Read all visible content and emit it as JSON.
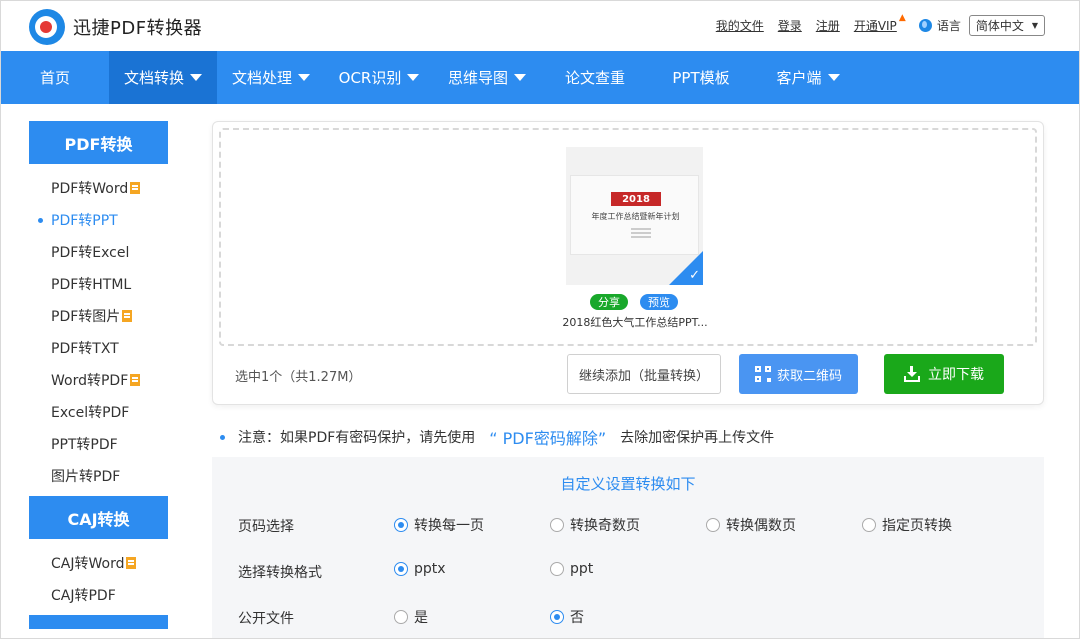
{
  "header": {
    "logo_text": "迅捷PDF转换器",
    "links": [
      "我的文件",
      "登录",
      "注册"
    ],
    "vip_label": "开通VIP",
    "lang_label": "语言",
    "lang_value": "简体中文"
  },
  "nav": {
    "items": [
      {
        "label": "首页"
      },
      {
        "label": "文档转换"
      },
      {
        "label": "文档处理"
      },
      {
        "label": "OCR识别"
      },
      {
        "label": "思维导图"
      },
      {
        "label": "论文查重"
      },
      {
        "label": "PPT模板"
      },
      {
        "label": "客户端"
      }
    ]
  },
  "sidebar": {
    "group1_title": "PDF转换",
    "group1_items": [
      "PDF转Word",
      "PDF转PPT",
      "PDF转Excel",
      "PDF转HTML",
      "PDF转图片",
      "PDF转TXT",
      "Word转PDF",
      "Excel转PDF",
      "PPT转PDF",
      "图片转PDF"
    ],
    "group2_title": "CAJ转换",
    "group2_items": [
      "CAJ转Word",
      "CAJ转PDF"
    ]
  },
  "upload": {
    "slide_tag": "2018",
    "slide_title": "年度工作总结暨新年计划",
    "share_label": "分享",
    "preview_label": "预览",
    "file_name": "2018红色大气工作总结PPT...",
    "selection_info": "选中1个（共1.27M）",
    "add_button": "继续添加（批量转换）",
    "qr_button": "获取二维码",
    "download_button": "立即下载"
  },
  "notice": {
    "prefix": "注意：如果PDF有密码保护，请先使用",
    "link": "“ PDF密码解除”",
    "suffix": "去除加密保护再上传文件"
  },
  "settings": {
    "title": "自定义设置转换如下",
    "page_label": "页码选择",
    "page_options": [
      "转换每一页",
      "转换奇数页",
      "转换偶数页",
      "指定页转换"
    ],
    "format_label": "选择转换格式",
    "format_options": [
      "pptx",
      "ppt"
    ],
    "public_label": "公开文件",
    "public_options": [
      "是",
      "否"
    ]
  }
}
